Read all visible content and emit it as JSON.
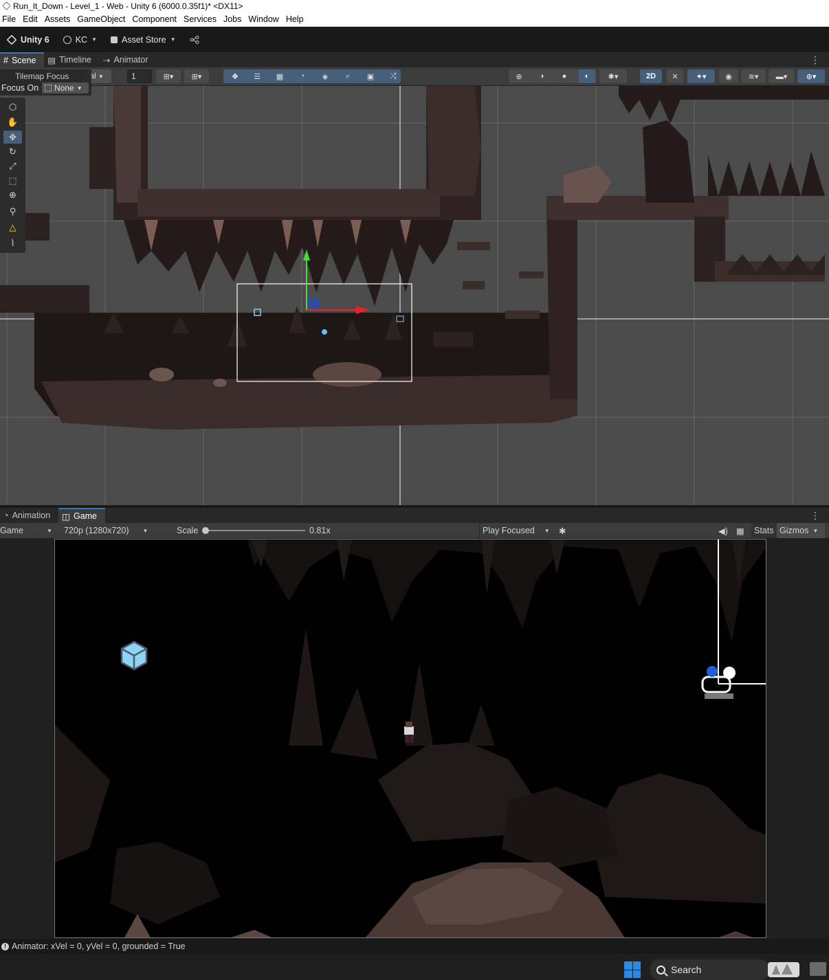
{
  "window": {
    "title": "Run_It_Down - Level_1 - Web - Unity 6 (6000.0.35f1)* <DX11>"
  },
  "menu": [
    "File",
    "Edit",
    "Assets",
    "GameObject",
    "Component",
    "Services",
    "Jobs",
    "Window",
    "Help"
  ],
  "toolbar": {
    "unity_label": "Unity 6",
    "account_label": "KC",
    "asset_store_label": "Asset Store"
  },
  "top_tabs": [
    {
      "label": "Scene",
      "icon": "grid-icon",
      "active": true
    },
    {
      "label": "Timeline",
      "icon": "timeline-icon",
      "active": false
    },
    {
      "label": "Animator",
      "icon": "animator-icon",
      "active": false
    }
  ],
  "scene_toolbar": {
    "pivot_partial": "al",
    "grid_size": "1",
    "mode_2d": "2D"
  },
  "tilemap_overlay": {
    "title": "Tilemap Focus",
    "focus_label": "Focus On",
    "focus_value": "None"
  },
  "bottom_tabs": [
    {
      "label": "Animation",
      "icon": "animation-icon",
      "active": false
    },
    {
      "label": "Game",
      "icon": "gamepad-icon",
      "active": true
    }
  ],
  "game_toolbar": {
    "display": "Game",
    "resolution": "720p (1280x720)",
    "scale_label": "Scale",
    "scale_value": "0.81x",
    "scale_fraction": 0.0,
    "play_mode": "Play Focused",
    "stats_label": "Stats",
    "gizmos_label": "Gizmos"
  },
  "status": {
    "message": "Animator: xVel = 0, yVel = 0, grounded = True"
  },
  "taskbar": {
    "search_label": "Search"
  },
  "colors": {
    "accent": "#3a79bb",
    "selected_tool": "#46607c",
    "scene_bg": "#4b4b4b",
    "rock": "#3a2c2a"
  }
}
